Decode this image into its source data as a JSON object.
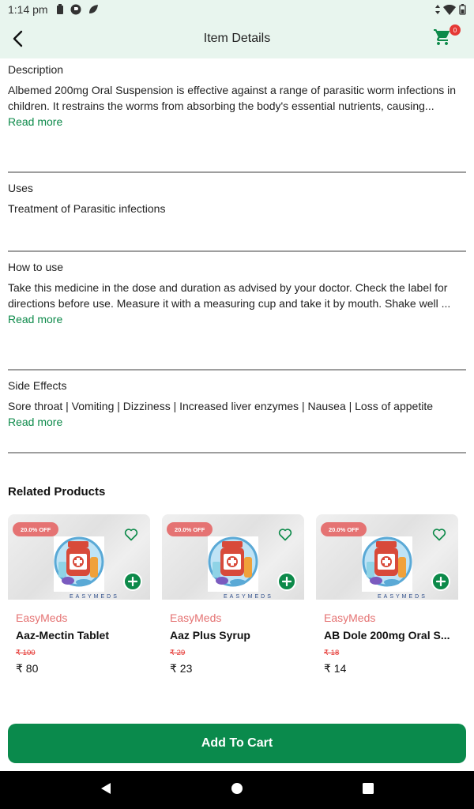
{
  "status_bar": {
    "time": "1:14 pm"
  },
  "app_bar": {
    "title": "Item Details",
    "cart_count": "0"
  },
  "description": {
    "heading": "Description",
    "text": "Albemed 200mg Oral Suspension is effective against a range of parasitic worm infections in children. It restrains the worms from absorbing the body's essential nutrients, causing...",
    "read_more": "Read more"
  },
  "uses": {
    "heading": "Uses",
    "text": "Treatment of Parasitic infections"
  },
  "how_to_use": {
    "heading": "How to use",
    "text": "Take this medicine in the dose and duration as advised by your doctor. Check the label for directions before use. Measure it with a measuring cup and take it by mouth. Shake well ...",
    "read_more": "Read more"
  },
  "side_effects": {
    "heading": "Side Effects",
    "text": "Sore throat | Vomiting | Dizziness | Increased liver enzymes | Nausea | Loss of appetite",
    "read_more": "Read more"
  },
  "related": {
    "title": "Related Products",
    "products": [
      {
        "offer": "20.0% OFF",
        "brand": "EasyMeds",
        "name": "Aaz-Mectin Tablet",
        "mrp": "₹ 100",
        "price": "₹ 80",
        "brandmark": "EASYMEDS"
      },
      {
        "offer": "20.0% OFF",
        "brand": "EasyMeds",
        "name": "Aaz Plus Syrup",
        "mrp": "₹ 29",
        "price": "₹ 23",
        "brandmark": "EASYMEDS"
      },
      {
        "offer": "20.0% OFF",
        "brand": "EasyMeds",
        "name": "AB Dole 200mg Oral S...",
        "mrp": "₹ 18",
        "price": "₹ 14",
        "brandmark": "EASYMEDS"
      }
    ]
  },
  "add_to_cart": "Add To Cart",
  "colors": {
    "primary": "#0a8a4c",
    "accent_red": "#e57373",
    "header_bg": "#e8f5ee"
  }
}
